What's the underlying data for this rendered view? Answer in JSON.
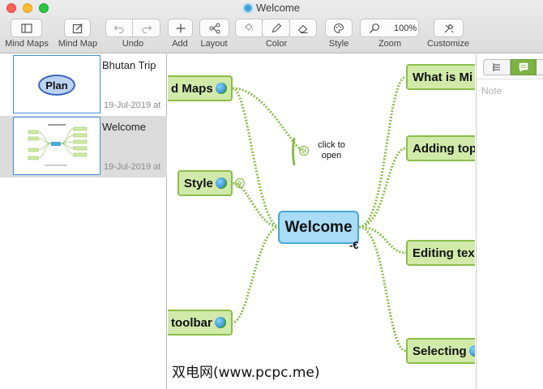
{
  "window": {
    "title": "Welcome"
  },
  "toolbar": {
    "mind_maps": "Mind Maps",
    "mind_map": "Mind Map",
    "undo": "Undo",
    "add": "Add",
    "layout": "Layout",
    "color": "Color",
    "style": "Style",
    "zoom": "Zoom",
    "zoom_level": "100%",
    "customize": "Customize"
  },
  "sidebar": {
    "documents": [
      {
        "title": "Bhutan Trip",
        "date": "19-Jul-2019 at",
        "thumb_node": "Plan"
      },
      {
        "title": "Welcome",
        "date": "19-Jul-2019 at"
      }
    ]
  },
  "canvas": {
    "central": "Welcome",
    "collapse_glyph": "-€",
    "link_label": "click to open",
    "left_nodes": [
      "d Maps",
      "Style",
      "toolbar"
    ],
    "right_nodes": [
      "What is Mi",
      "Adding top",
      "Editing tex",
      "Selecting"
    ],
    "watermark": "双电网(www.pcpc.me)",
    "colors": {
      "central_fill": "#a8dcf7",
      "node_fill": "#d1eaaa",
      "link": "#8cbd4a"
    }
  },
  "inspector": {
    "note_placeholder": "Note"
  }
}
